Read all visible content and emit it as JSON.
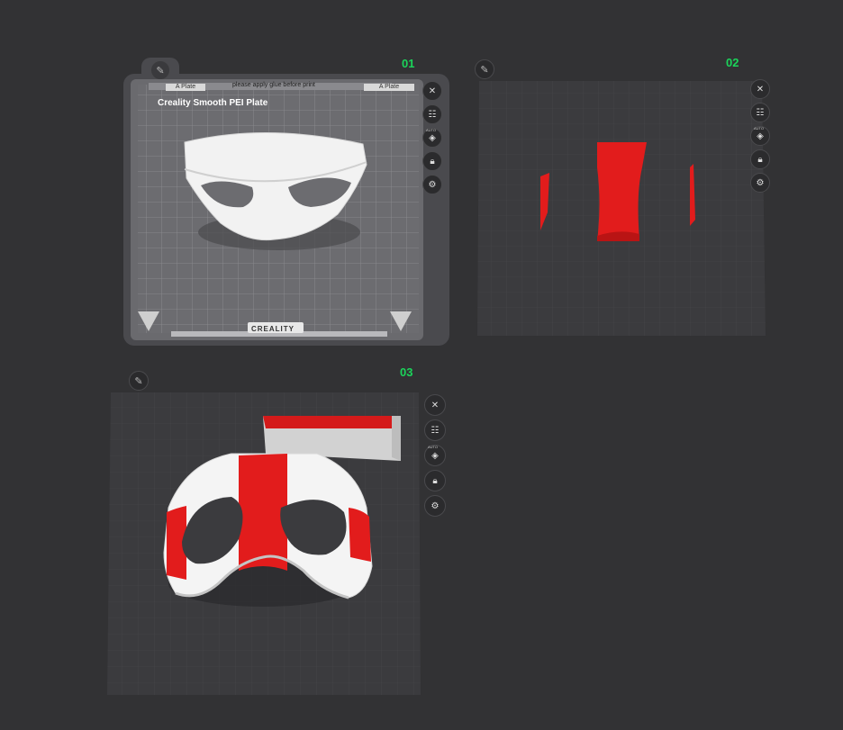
{
  "plates": [
    {
      "number": "01",
      "bed_name": "Creality Smooth PEI Plate",
      "top_left_tag": "A Plate",
      "top_right_tag": "A Plate",
      "top_notice": "please apply glue before print",
      "brand": "CREALITY",
      "model_color": "white"
    },
    {
      "number": "02",
      "model_color": "red"
    },
    {
      "number": "03",
      "model_colors": [
        "white",
        "red"
      ]
    }
  ],
  "icons": {
    "edit": "pencil-icon",
    "close": "close-icon",
    "arrange": "arrange-icon",
    "auto_orient": "auto-orient-icon",
    "lock": "lock-icon",
    "settings": "gear-icon"
  },
  "tool_labels": {
    "auto": "AUTO"
  },
  "colors": {
    "plate_number": "#1bd45a",
    "background": "#323234",
    "red": "#e02020"
  }
}
